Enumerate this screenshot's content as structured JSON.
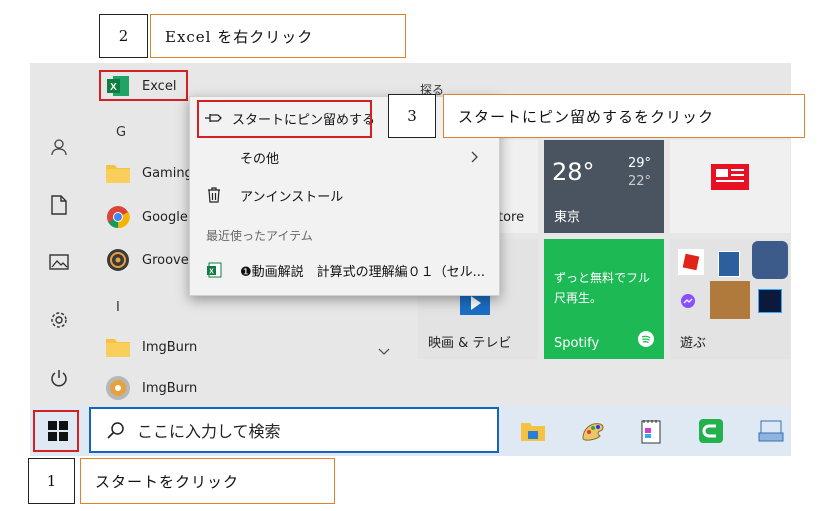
{
  "annotations": {
    "step1_number": "1",
    "step1_text": "スタートをクリック",
    "step2_number": "2",
    "step2_text": "Excel を右クリック",
    "step3_number": "3",
    "step3_text": "スタートにピン留めするをクリック"
  },
  "app_list": {
    "excel": "Excel",
    "group_g": "G",
    "gaming": "Gaming",
    "google": "Google",
    "groove": "Groove",
    "group_i": "I",
    "imgburn_folder": "ImgBurn",
    "imgburn_app": "ImgBurn"
  },
  "context_menu": {
    "pin_to_start": "スタートにピン留めする",
    "more": "その他",
    "uninstall": "アンインストール",
    "recent_header": "最近使ったアイテム",
    "recent_file": "❶動画解説　計算式の理解編０１（セル..."
  },
  "tiles": {
    "header": "探る",
    "store_label": "tore",
    "weather_temp": "28°",
    "weather_high": "29°",
    "weather_low": "22°",
    "weather_city": "東京",
    "spotify_text1": "ずっと無料でフル",
    "spotify_text2": "尺再生。",
    "spotify_label": "Spotify",
    "movies_label": "映画 & テレビ",
    "play_label": "遊ぶ"
  },
  "taskbar": {
    "search_placeholder": "ここに入力して検索"
  },
  "colors": {
    "weather_tile": "#4a5460",
    "spotify_tile": "#1db954",
    "movies_tile": "#e3e3e3",
    "taskbar": "#dfe9f3",
    "search_border": "#1565c0",
    "highlight_red": "#d32020",
    "annotation_orange": "#e0822c"
  }
}
